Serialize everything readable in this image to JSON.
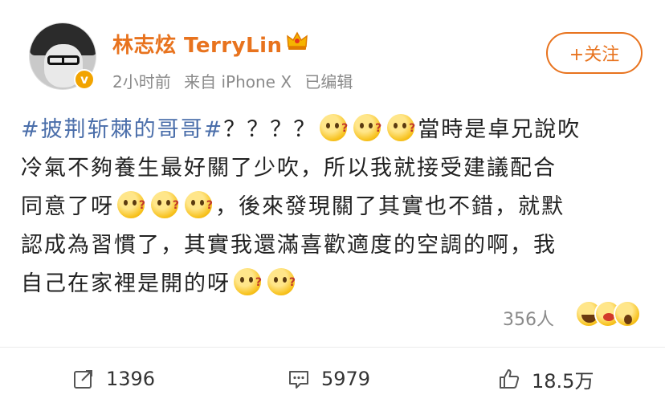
{
  "user": {
    "name": "林志炫 TerryLin",
    "verified_badge": "v",
    "crown_icon": "crown-icon"
  },
  "meta": {
    "time": "2小时前",
    "source": "来自 iPhone X",
    "edited": "已编辑"
  },
  "follow_button": "+关注",
  "content": {
    "hashtag": "#披荆斩棘的哥哥#",
    "line1_rest": "？？？？",
    "line1_tail": "當時是卓兄說吹",
    "line2": "冷氣不夠養生最好關了少吹，所以我就接受建議配合",
    "line3_head": "同意了呀",
    "line3_tail": "，後來發現關了其實也不錯，就默",
    "line4": "認成為習慣了，其實我還滿喜歡適度的空調的啊，我",
    "line5_head": "自己在家裡是開的呀"
  },
  "reactions": {
    "count": "356人"
  },
  "actions": {
    "repost": "1396",
    "comment": "5979",
    "like": "18.5万"
  },
  "colors": {
    "accent": "#e8731e",
    "hashtag": "#4a6eaa",
    "meta": "#8a8a8a"
  }
}
